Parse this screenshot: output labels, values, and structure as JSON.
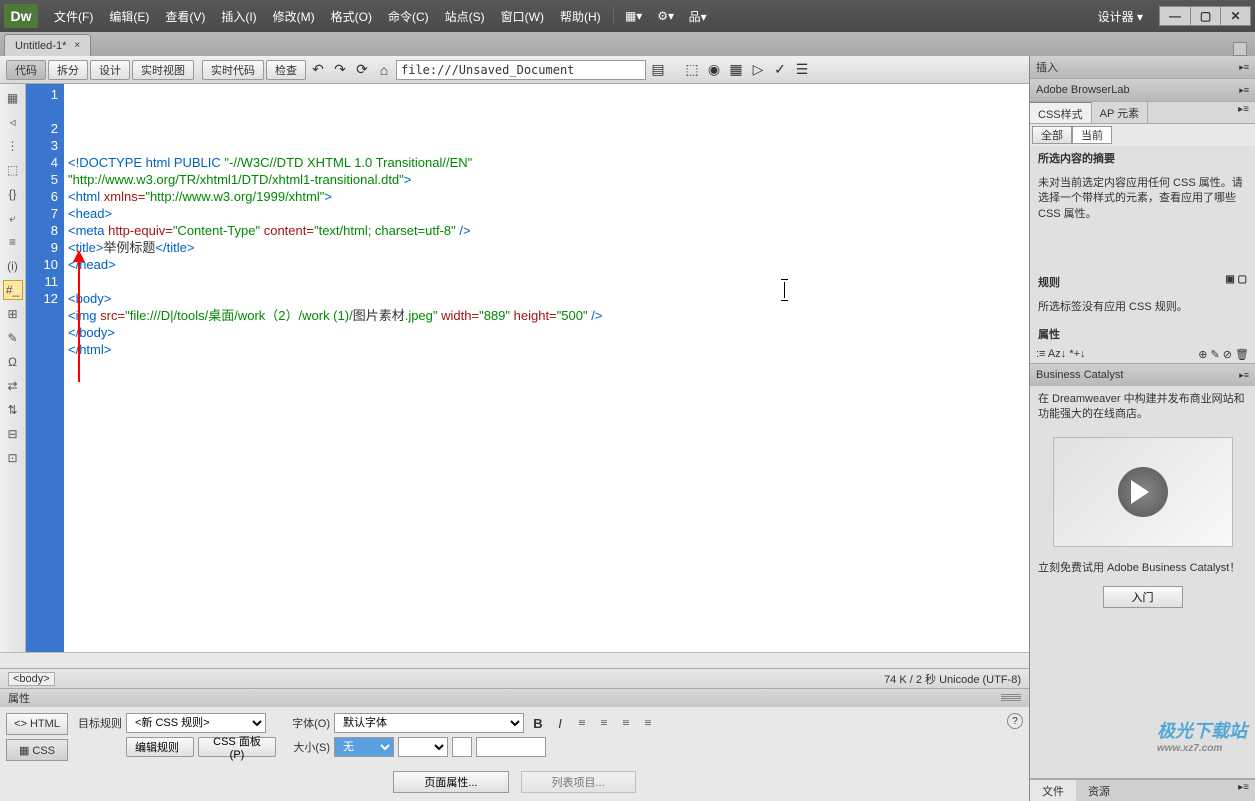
{
  "menubar": {
    "logo": "Dw",
    "items": [
      "文件(F)",
      "编辑(E)",
      "查看(V)",
      "插入(I)",
      "修改(M)",
      "格式(O)",
      "命令(C)",
      "站点(S)",
      "窗口(W)",
      "帮助(H)"
    ],
    "designer": "设计器 ▾"
  },
  "tabbar": {
    "tab_title": "Untitled-1*"
  },
  "toolbar": {
    "buttons": [
      "代码",
      "拆分",
      "设计",
      "实时视图"
    ],
    "buttons2": [
      "实时代码",
      "检查"
    ],
    "address": "file:///Unsaved_Document"
  },
  "side_tools": [
    "▦",
    "◃",
    "⋮",
    "⬚",
    "{}",
    "⤶",
    "≡",
    "(i)",
    "#_",
    "⊞",
    "✎",
    "Ω",
    "⇄",
    "⇅",
    "⊟",
    "⊡"
  ],
  "code_lines": [
    {
      "n": "1",
      "html": "<span class='c-tag'>&lt;!DOCTYPE html PUBLIC </span><span class='c-str'>\"-//W3C//DTD XHTML 1.0 Transitional//EN\"</span>"
    },
    {
      "n": "",
      "html": "<span class='c-str'>\"http://www.w3.org/TR/xhtml1/DTD/xhtml1-transitional.dtd\"</span><span class='c-tag'>&gt;</span>"
    },
    {
      "n": "2",
      "html": "<span class='c-tag'>&lt;html</span> <span class='c-attr'>xmlns=</span><span class='c-str'>\"http://www.w3.org/1999/xhtml\"</span><span class='c-tag'>&gt;</span>"
    },
    {
      "n": "3",
      "html": "<span class='c-tag'>&lt;head&gt;</span>"
    },
    {
      "n": "4",
      "html": "<span class='c-tag'>&lt;meta</span> <span class='c-attr'>http-equiv=</span><span class='c-str'>\"Content-Type\"</span> <span class='c-attr'>content=</span><span class='c-str'>\"text/html; charset=utf-8\"</span> <span class='c-tag'>/&gt;</span>"
    },
    {
      "n": "5",
      "html": "<span class='c-tag'>&lt;title&gt;</span><span class='c-txt'>举例标题</span><span class='c-tag'>&lt;/title&gt;</span>"
    },
    {
      "n": "6",
      "html": "<span class='c-tag'>&lt;/head&gt;</span>"
    },
    {
      "n": "7",
      "html": ""
    },
    {
      "n": "8",
      "html": "<span class='c-tag'>&lt;body&gt;</span>"
    },
    {
      "n": "9",
      "html": "<span class='c-tag'>&lt;img</span> <span class='c-attr'>src=</span><span class='c-str'>\"file:///D|/tools/桌面/work（2）/work (1)/</span><span class='c-txt'>图片素材</span><span class='c-str'>.jpeg\"</span> <span class='c-attr'>width=</span><span class='c-str'>\"889\"</span> <span class='c-attr'>height=</span><span class='c-str'>\"500\"</span> <span class='c-tag'>/&gt;</span>"
    },
    {
      "n": "10",
      "html": "<span class='c-tag'>&lt;/body&gt;</span>"
    },
    {
      "n": "11",
      "html": "<span class='c-tag'>&lt;/html&gt;</span>"
    },
    {
      "n": "12",
      "html": ""
    }
  ],
  "statusbar": {
    "tag": "<body>",
    "info": "74 K / 2 秒 Unicode (UTF-8)"
  },
  "props": {
    "title": "属性",
    "mode_html": "<> HTML",
    "mode_css": "▦ CSS",
    "target_rule_label": "目标规则",
    "target_rule_value": "<新 CSS 规则>",
    "edit_rule": "编辑规则",
    "css_panel": "CSS 面板(P)",
    "font_label": "字体(O)",
    "font_value": "默认字体",
    "size_label": "大小(S)",
    "size_value": "无",
    "page_props": "页面属性...",
    "list_item": "列表项目..."
  },
  "right": {
    "insert": "插入",
    "browserlab": "Adobe BrowserLab",
    "css_tab": "CSS样式",
    "ap_tab": "AP 元素",
    "all": "全部",
    "current": "当前",
    "summary_title": "所选内容的摘要",
    "summary_text": "未对当前选定内容应用任何 CSS 属性。请选择一个带样式的元素，查看应用了哪些 CSS 属性。",
    "rules_title": "规则",
    "rules_text": "所选标签没有应用 CSS 规则。",
    "props_title": "属性",
    "bc_title": "Business Catalyst",
    "bc_text": "在 Dreamweaver 中构建并发布商业网站和功能强大的在线商店。",
    "bc_cta": "立刻免费试用 Adobe Business Catalyst！",
    "bc_btn": "入门",
    "files_tab": "文件",
    "assets_tab": "资源"
  },
  "watermark": {
    "brand": "极光下载站",
    "url": "www.xz7.com"
  }
}
